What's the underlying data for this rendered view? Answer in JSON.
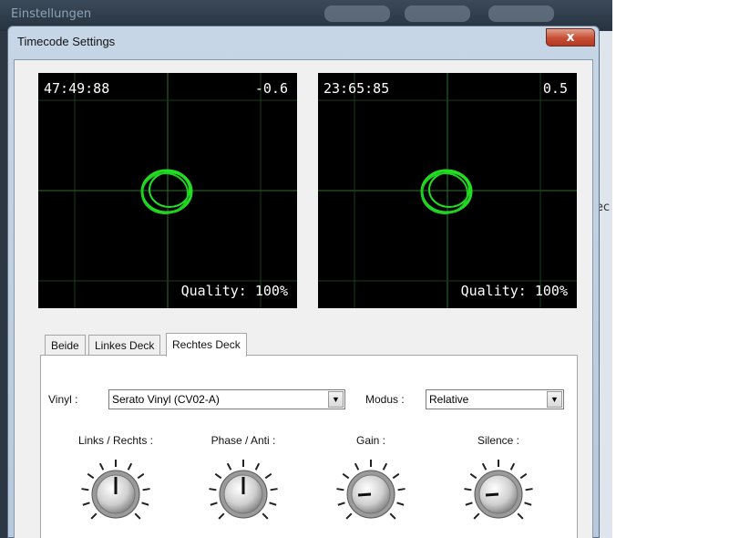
{
  "background_window": {
    "title": "Einstellungen",
    "side_text": "ec"
  },
  "dialog": {
    "title": "Timecode Settings",
    "close_label": "x"
  },
  "scopes": [
    {
      "timecode": "47:49:88",
      "pitch": "-0.6",
      "quality": "Quality: 100%"
    },
    {
      "timecode": "23:65:85",
      "pitch": "0.5",
      "quality": "Quality: 100%"
    }
  ],
  "tabs": [
    {
      "label": "Beide",
      "active": false
    },
    {
      "label": "Linkes Deck",
      "active": false
    },
    {
      "label": "Rechtes Deck",
      "active": true
    }
  ],
  "vinyl": {
    "label": "Vinyl :",
    "value": "Serato Vinyl (CV02-A)"
  },
  "modus": {
    "label": "Modus :",
    "value": "Relative"
  },
  "knobs": [
    {
      "label": "Links / Rechts :",
      "pointer": "up"
    },
    {
      "label": "Phase / Anti :",
      "pointer": "up"
    },
    {
      "label": "Gain :",
      "pointer": "left"
    },
    {
      "label": "Silence :",
      "pointer": "left"
    }
  ],
  "colors": {
    "scope_trace": "#22dd22",
    "scope_grid": "#2f6b2f",
    "scope_bg": "#000000",
    "close_button": "#c74d34"
  }
}
